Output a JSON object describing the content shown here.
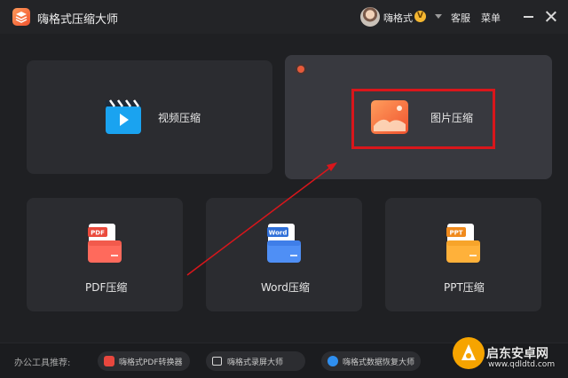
{
  "titlebar": {
    "app_title": "嗨格式压缩大师",
    "user_name": "嗨格式",
    "vip_badge": "V",
    "support_label": "客服",
    "menu_label": "菜单"
  },
  "cards": {
    "video": {
      "label": "视频压缩"
    },
    "image": {
      "label": "图片压缩"
    },
    "pdf": {
      "label": "PDF压缩",
      "file_tag": "PDF"
    },
    "word": {
      "label": "Word压缩",
      "file_tag": "Word"
    },
    "ppt": {
      "label": "PPT压缩",
      "file_tag": "PPT"
    }
  },
  "footer": {
    "label": "办公工具推荐:",
    "tools": [
      {
        "name": "嗨格式PDF转换器",
        "icon": "pdf-converter-icon",
        "color": "#e8473e"
      },
      {
        "name": "嗨格式录屏大师",
        "icon": "screen-recorder-icon",
        "color": "#d8d8d8"
      },
      {
        "name": "嗨格式数据恢复大师",
        "icon": "data-recovery-icon",
        "color": "#2f8ff0"
      }
    ]
  },
  "watermark": {
    "name": "启东安卓网",
    "url": "www.qdldtd.com"
  },
  "colors": {
    "background": "#1f2023",
    "card": "#2b2c30",
    "card_active": "#38393f",
    "highlight": "#d9161b",
    "accent_orange": "#f0532f"
  }
}
